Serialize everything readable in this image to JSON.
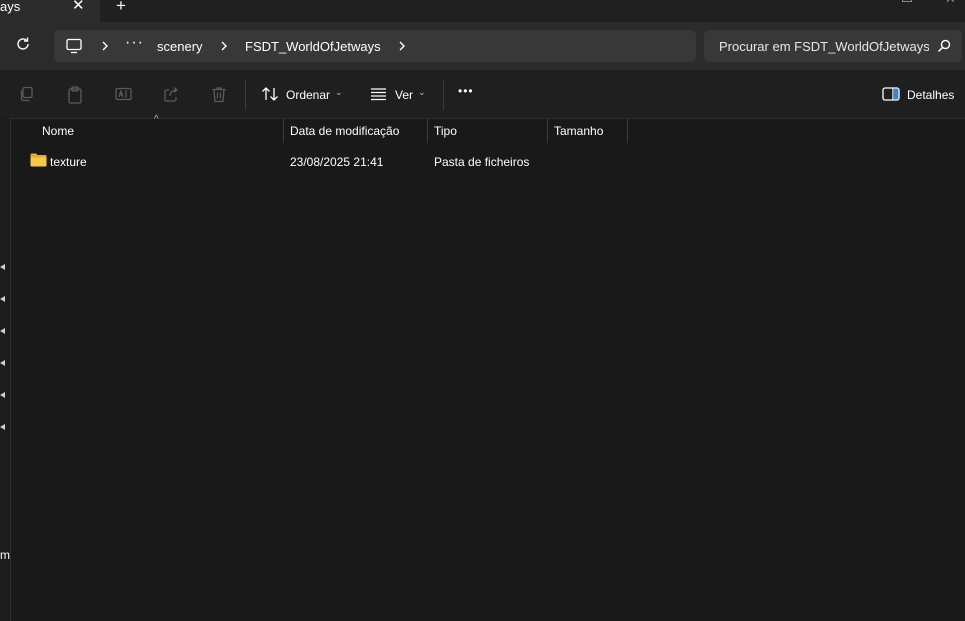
{
  "tab": {
    "title": "ays",
    "close": "✕",
    "new_tab": "+"
  },
  "address": {
    "more": "···",
    "breadcrumb": [
      "scenery",
      "FSDT_WorldOfJetways"
    ],
    "search_placeholder": "Procurar em FSDT_WorldOfJetways"
  },
  "toolbar": {
    "sort_label": "Ordenar",
    "view_label": "Ver",
    "more": "•••",
    "details_label": "Detalhes"
  },
  "columns": [
    "Nome",
    "Data de modificação",
    "Tipo",
    "Tamanho"
  ],
  "rows": [
    {
      "name": "texture",
      "modified": "23/08/2025 21:41",
      "type": "Pasta de ficheiros",
      "size": ""
    }
  ],
  "nav_pane": {
    "partial_text": "m"
  },
  "colors": {
    "background": "#191919",
    "toolbar": "#1f1f1f",
    "address_bar": "#2b2b2b",
    "folder": "#f5c342"
  }
}
